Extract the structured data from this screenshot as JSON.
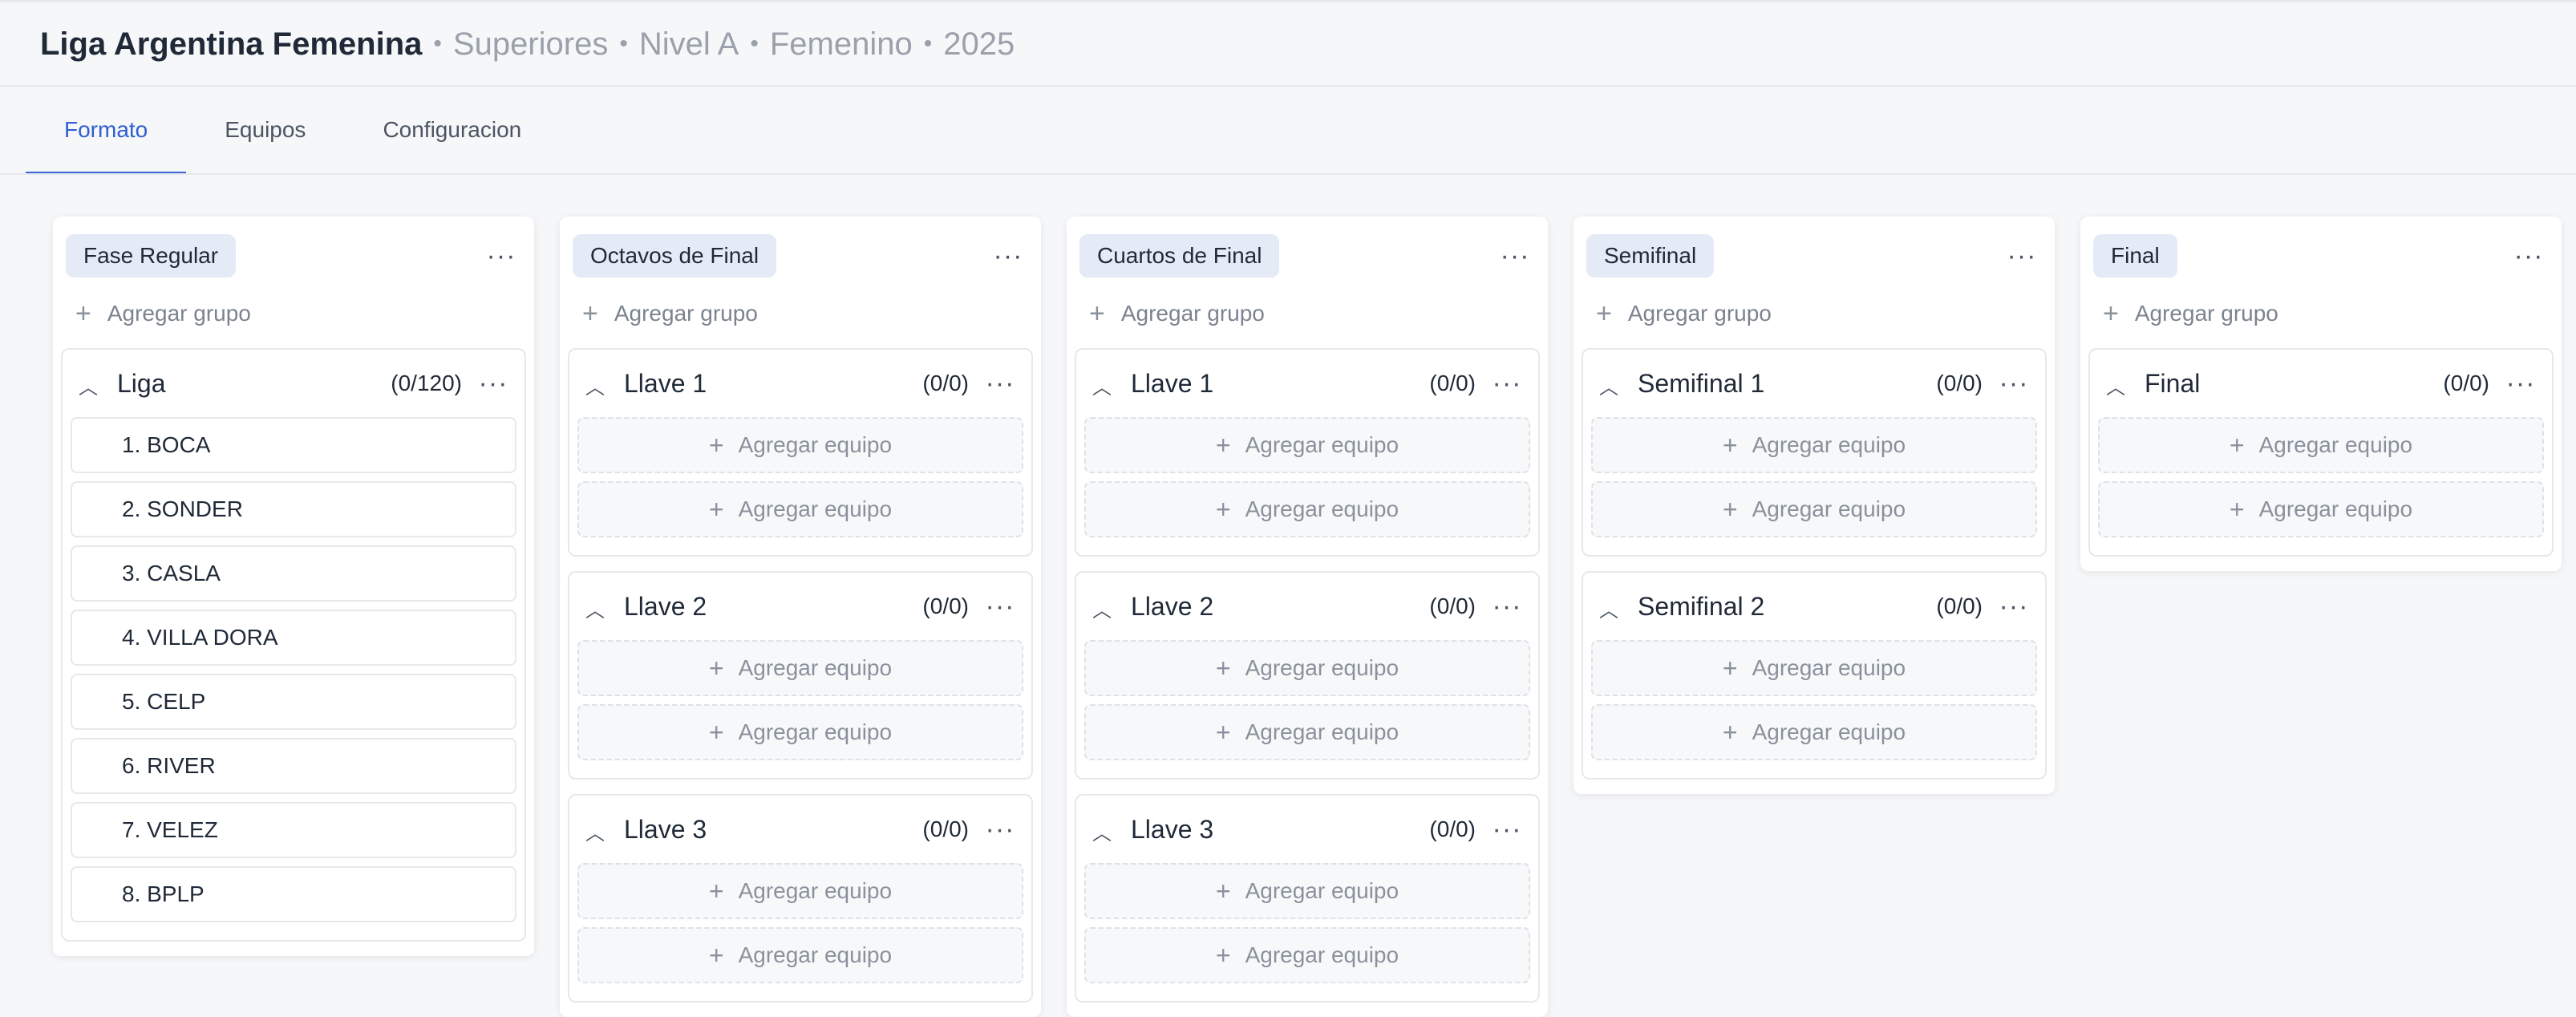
{
  "header": {
    "title": "Liga Argentina Femenina",
    "crumbs": [
      "Superiores",
      "Nivel A",
      "Femenino",
      "2025"
    ],
    "separator": "•"
  },
  "tabs": [
    {
      "label": "Formato",
      "active": true
    },
    {
      "label": "Equipos",
      "active": false
    },
    {
      "label": "Configuracion",
      "active": false
    }
  ],
  "labels": {
    "add_group": "Agregar grupo",
    "add_team": "Agregar equipo",
    "menu": "···"
  },
  "columns": [
    {
      "phase": "Fase Regular",
      "groups": [
        {
          "name": "Liga",
          "count": "(0/120)",
          "teams": [
            "1. BOCA",
            "2. SONDER",
            "3. CASLA",
            "4. VILLA DORA",
            "5. CELP",
            "6. RIVER",
            "7. VELEZ",
            "8. BPLP"
          ]
        }
      ]
    },
    {
      "phase": "Octavos de Final",
      "groups": [
        {
          "name": "Llave 1",
          "count": "(0/0)",
          "slots": 2
        },
        {
          "name": "Llave 2",
          "count": "(0/0)",
          "slots": 2
        },
        {
          "name": "Llave 3",
          "count": "(0/0)",
          "slots": 2
        }
      ]
    },
    {
      "phase": "Cuartos de Final",
      "groups": [
        {
          "name": "Llave 1",
          "count": "(0/0)",
          "slots": 2
        },
        {
          "name": "Llave 2",
          "count": "(0/0)",
          "slots": 2
        },
        {
          "name": "Llave 3",
          "count": "(0/0)",
          "slots": 2
        }
      ]
    },
    {
      "phase": "Semifinal",
      "groups": [
        {
          "name": "Semifinal 1",
          "count": "(0/0)",
          "slots": 2
        },
        {
          "name": "Semifinal 2",
          "count": "(0/0)",
          "slots": 2
        }
      ]
    },
    {
      "phase": "Final",
      "groups": [
        {
          "name": "Final",
          "count": "(0/0)",
          "slots": 2
        }
      ]
    }
  ],
  "colors": {
    "accent": "#3b66d6",
    "pill": "#e4ebf7",
    "background": "#f6f7f9"
  }
}
